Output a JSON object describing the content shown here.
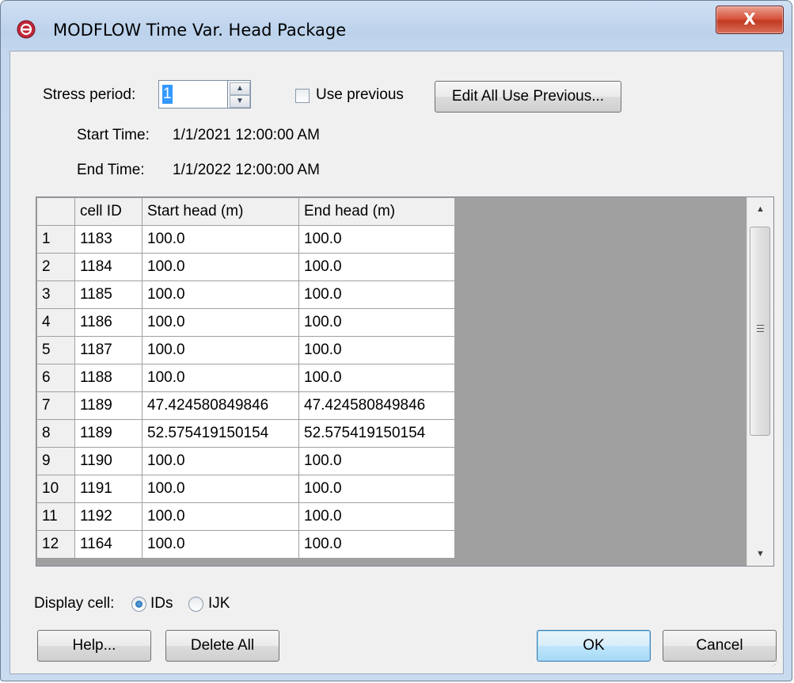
{
  "window": {
    "title": "MODFLOW Time Var. Head Package",
    "close_label": "X"
  },
  "stress_period": {
    "label": "Stress period:",
    "value": "1",
    "use_previous_label": "Use previous",
    "use_previous_checked": false,
    "edit_all_label": "Edit All Use Previous..."
  },
  "times": {
    "start_label": "Start Time:",
    "start_value": "1/1/2021 12:00:00 AM",
    "end_label": "End Time:",
    "end_value": "1/1/2022 12:00:00 AM"
  },
  "table": {
    "columns": [
      "",
      "cell ID",
      "Start head (m)",
      "End head (m)"
    ],
    "rows": [
      [
        "1",
        "1183",
        "100.0",
        "100.0"
      ],
      [
        "2",
        "1184",
        "100.0",
        "100.0"
      ],
      [
        "3",
        "1185",
        "100.0",
        "100.0"
      ],
      [
        "4",
        "1186",
        "100.0",
        "100.0"
      ],
      [
        "5",
        "1187",
        "100.0",
        "100.0"
      ],
      [
        "6",
        "1188",
        "100.0",
        "100.0"
      ],
      [
        "7",
        "1189",
        "47.424580849846",
        "47.424580849846"
      ],
      [
        "8",
        "1189",
        "52.575419150154",
        "52.575419150154"
      ],
      [
        "9",
        "1190",
        "100.0",
        "100.0"
      ],
      [
        "10",
        "1191",
        "100.0",
        "100.0"
      ],
      [
        "11",
        "1192",
        "100.0",
        "100.0"
      ],
      [
        "12",
        "1164",
        "100.0",
        "100.0"
      ]
    ]
  },
  "display_cell": {
    "label": "Display cell:",
    "options": [
      "IDs",
      "IJK"
    ],
    "selected": "IDs"
  },
  "buttons": {
    "help": "Help...",
    "delete_all": "Delete All",
    "ok": "OK",
    "cancel": "Cancel"
  },
  "colors": {
    "title_bar": "#bcd2ec",
    "close_button": "#c23a22",
    "table_empty_area": "#a0a0a0",
    "selection": "#3399ff"
  }
}
